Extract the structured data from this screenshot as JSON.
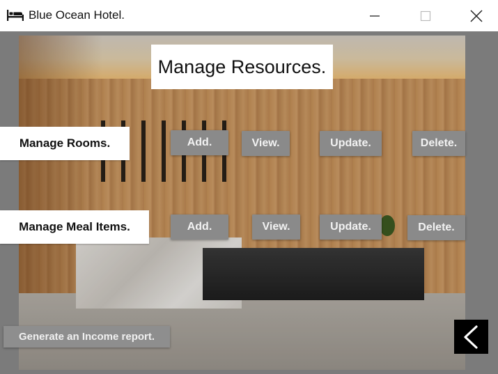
{
  "window": {
    "title": "Blue Ocean Hotel.",
    "icon": "bed-icon",
    "controls": {
      "minimize_icon": "minimize-icon",
      "maximize_icon": "maximize-icon",
      "close_icon": "close-icon"
    }
  },
  "main": {
    "heading": "Manage Resources.",
    "rooms": {
      "label": "Manage Rooms.",
      "add": "Add.",
      "view": "View.",
      "update": "Update.",
      "delete": "Delete."
    },
    "meals": {
      "label": "Manage Meal Items.",
      "add": "Add.",
      "view": "View.",
      "update": "Update.",
      "delete": "Delete."
    },
    "report_button": "Generate an Income report.",
    "back_icon": "chevron-left-icon"
  },
  "colors": {
    "button_bg": "#8a8a8a",
    "button_text": "#f2f2f2",
    "label_bg": "#ffffff",
    "back_bg": "#000000"
  }
}
